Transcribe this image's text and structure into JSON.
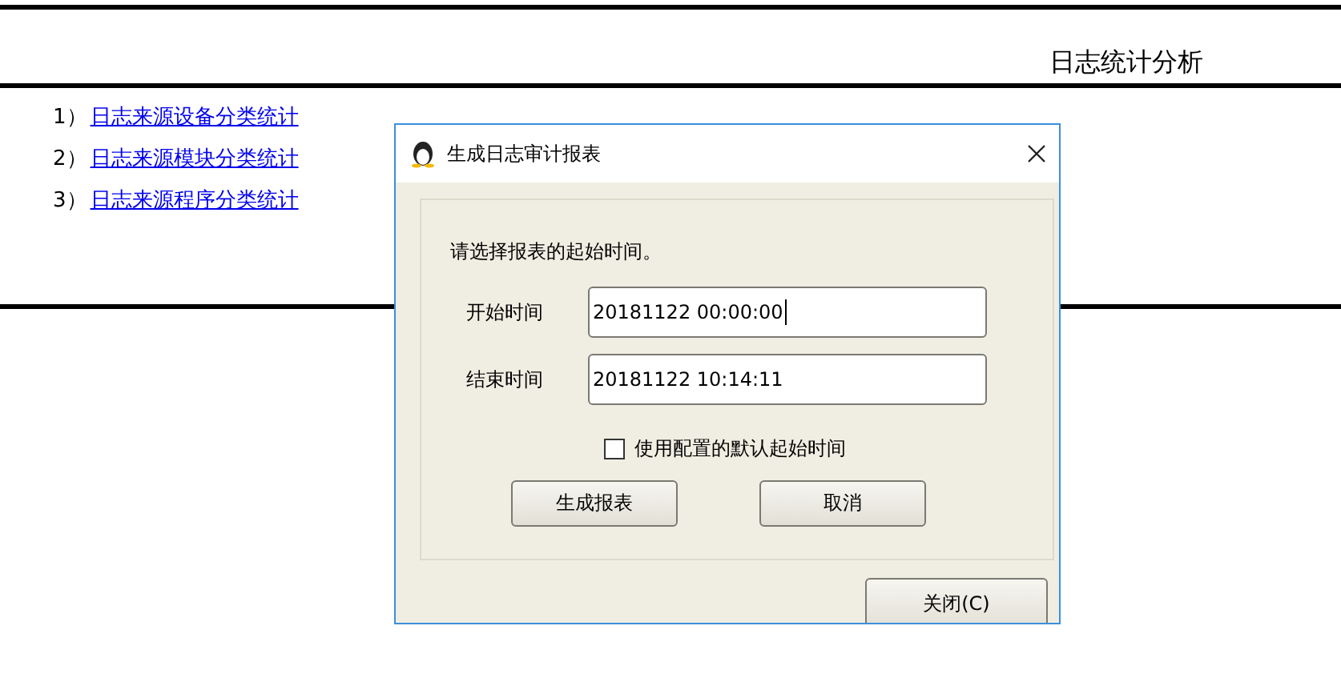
{
  "page": {
    "title": "日志统计分析",
    "links": [
      {
        "number": "1）",
        "label": "日志来源设备分类统计"
      },
      {
        "number": "2）",
        "label": "日志来源模块分类统计"
      },
      {
        "number": "3）",
        "label": "日志来源程序分类统计"
      }
    ]
  },
  "dialog": {
    "title": "生成日志审计报表",
    "prompt": "请选择报表的起始时间。",
    "fields": [
      {
        "label": "开始时间",
        "value": "20181122 00:00:00",
        "focused": true
      },
      {
        "label": "结束时间",
        "value": "20181122 10:14:11",
        "focused": false
      }
    ],
    "checkbox": {
      "label": "使用配置的默认起始时间",
      "checked": false
    },
    "buttons": [
      "生成报表",
      "取消"
    ],
    "close_button": "关闭(C)"
  }
}
